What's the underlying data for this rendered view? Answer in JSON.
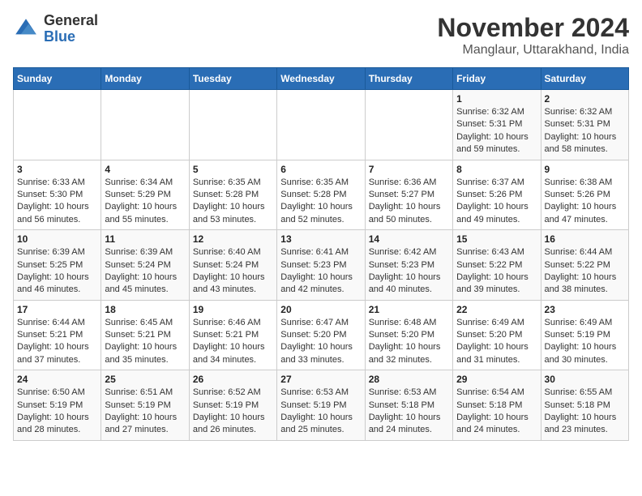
{
  "logo": {
    "general": "General",
    "blue": "Blue"
  },
  "title": "November 2024",
  "subtitle": "Manglaur, Uttarakhand, India",
  "days_of_week": [
    "Sunday",
    "Monday",
    "Tuesday",
    "Wednesday",
    "Thursday",
    "Friday",
    "Saturday"
  ],
  "weeks": [
    [
      {
        "day": "",
        "info": ""
      },
      {
        "day": "",
        "info": ""
      },
      {
        "day": "",
        "info": ""
      },
      {
        "day": "",
        "info": ""
      },
      {
        "day": "",
        "info": ""
      },
      {
        "day": "1",
        "info": "Sunrise: 6:32 AM\nSunset: 5:31 PM\nDaylight: 10 hours and 59 minutes."
      },
      {
        "day": "2",
        "info": "Sunrise: 6:32 AM\nSunset: 5:31 PM\nDaylight: 10 hours and 58 minutes."
      }
    ],
    [
      {
        "day": "3",
        "info": "Sunrise: 6:33 AM\nSunset: 5:30 PM\nDaylight: 10 hours and 56 minutes."
      },
      {
        "day": "4",
        "info": "Sunrise: 6:34 AM\nSunset: 5:29 PM\nDaylight: 10 hours and 55 minutes."
      },
      {
        "day": "5",
        "info": "Sunrise: 6:35 AM\nSunset: 5:28 PM\nDaylight: 10 hours and 53 minutes."
      },
      {
        "day": "6",
        "info": "Sunrise: 6:35 AM\nSunset: 5:28 PM\nDaylight: 10 hours and 52 minutes."
      },
      {
        "day": "7",
        "info": "Sunrise: 6:36 AM\nSunset: 5:27 PM\nDaylight: 10 hours and 50 minutes."
      },
      {
        "day": "8",
        "info": "Sunrise: 6:37 AM\nSunset: 5:26 PM\nDaylight: 10 hours and 49 minutes."
      },
      {
        "day": "9",
        "info": "Sunrise: 6:38 AM\nSunset: 5:26 PM\nDaylight: 10 hours and 47 minutes."
      }
    ],
    [
      {
        "day": "10",
        "info": "Sunrise: 6:39 AM\nSunset: 5:25 PM\nDaylight: 10 hours and 46 minutes."
      },
      {
        "day": "11",
        "info": "Sunrise: 6:39 AM\nSunset: 5:24 PM\nDaylight: 10 hours and 45 minutes."
      },
      {
        "day": "12",
        "info": "Sunrise: 6:40 AM\nSunset: 5:24 PM\nDaylight: 10 hours and 43 minutes."
      },
      {
        "day": "13",
        "info": "Sunrise: 6:41 AM\nSunset: 5:23 PM\nDaylight: 10 hours and 42 minutes."
      },
      {
        "day": "14",
        "info": "Sunrise: 6:42 AM\nSunset: 5:23 PM\nDaylight: 10 hours and 40 minutes."
      },
      {
        "day": "15",
        "info": "Sunrise: 6:43 AM\nSunset: 5:22 PM\nDaylight: 10 hours and 39 minutes."
      },
      {
        "day": "16",
        "info": "Sunrise: 6:44 AM\nSunset: 5:22 PM\nDaylight: 10 hours and 38 minutes."
      }
    ],
    [
      {
        "day": "17",
        "info": "Sunrise: 6:44 AM\nSunset: 5:21 PM\nDaylight: 10 hours and 37 minutes."
      },
      {
        "day": "18",
        "info": "Sunrise: 6:45 AM\nSunset: 5:21 PM\nDaylight: 10 hours and 35 minutes."
      },
      {
        "day": "19",
        "info": "Sunrise: 6:46 AM\nSunset: 5:21 PM\nDaylight: 10 hours and 34 minutes."
      },
      {
        "day": "20",
        "info": "Sunrise: 6:47 AM\nSunset: 5:20 PM\nDaylight: 10 hours and 33 minutes."
      },
      {
        "day": "21",
        "info": "Sunrise: 6:48 AM\nSunset: 5:20 PM\nDaylight: 10 hours and 32 minutes."
      },
      {
        "day": "22",
        "info": "Sunrise: 6:49 AM\nSunset: 5:20 PM\nDaylight: 10 hours and 31 minutes."
      },
      {
        "day": "23",
        "info": "Sunrise: 6:49 AM\nSunset: 5:19 PM\nDaylight: 10 hours and 30 minutes."
      }
    ],
    [
      {
        "day": "24",
        "info": "Sunrise: 6:50 AM\nSunset: 5:19 PM\nDaylight: 10 hours and 28 minutes."
      },
      {
        "day": "25",
        "info": "Sunrise: 6:51 AM\nSunset: 5:19 PM\nDaylight: 10 hours and 27 minutes."
      },
      {
        "day": "26",
        "info": "Sunrise: 6:52 AM\nSunset: 5:19 PM\nDaylight: 10 hours and 26 minutes."
      },
      {
        "day": "27",
        "info": "Sunrise: 6:53 AM\nSunset: 5:19 PM\nDaylight: 10 hours and 25 minutes."
      },
      {
        "day": "28",
        "info": "Sunrise: 6:53 AM\nSunset: 5:18 PM\nDaylight: 10 hours and 24 minutes."
      },
      {
        "day": "29",
        "info": "Sunrise: 6:54 AM\nSunset: 5:18 PM\nDaylight: 10 hours and 24 minutes."
      },
      {
        "day": "30",
        "info": "Sunrise: 6:55 AM\nSunset: 5:18 PM\nDaylight: 10 hours and 23 minutes."
      }
    ]
  ]
}
